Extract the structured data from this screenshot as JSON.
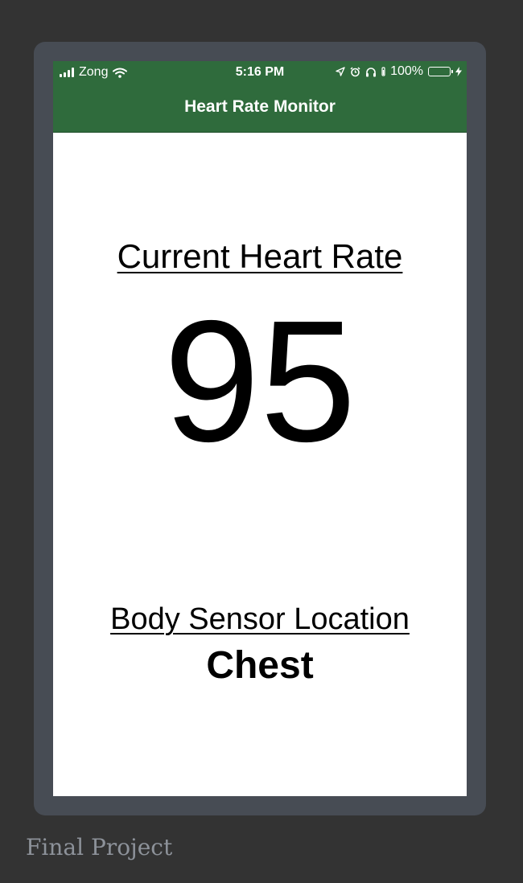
{
  "status_bar": {
    "carrier": "Zong",
    "time": "5:16 PM",
    "battery_percent": "100%",
    "battery_level": 1.0,
    "icons": [
      "signal-bars-icon",
      "wifi-icon",
      "location-arrow-icon",
      "alarm-icon",
      "headphones-icon",
      "battery-icon",
      "charging-bolt-icon"
    ]
  },
  "nav": {
    "title": "Heart Rate Monitor"
  },
  "heart_rate": {
    "label": "Current Heart Rate",
    "value": "95"
  },
  "sensor": {
    "label": "Body Sensor Location",
    "value": "Chest"
  },
  "caption": "Final Project",
  "colors": {
    "background": "#333333",
    "device_frame": "#474c54",
    "nav_green": "#2f6b3c",
    "battery_green": "#4cd964",
    "caption_gray": "#8d929a"
  }
}
